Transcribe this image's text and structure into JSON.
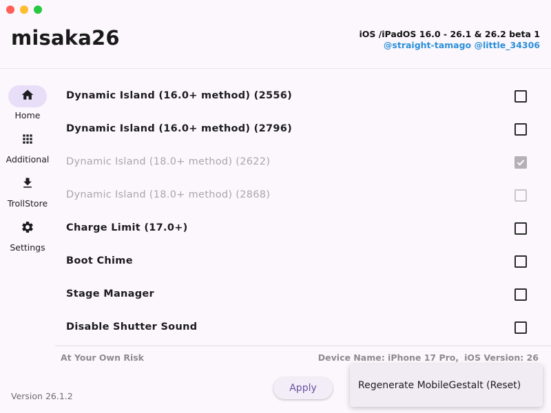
{
  "window": {
    "controls": [
      "close",
      "minimize",
      "maximize"
    ]
  },
  "header": {
    "app_title": "misaka26",
    "os_range": "iOS /iPadOS 16.0 - 26.1 & 26.2 beta 1",
    "credits": "@straight-tamago @little_34306"
  },
  "sidebar": {
    "items": [
      {
        "label": "Home",
        "icon": "home-icon",
        "selected": true
      },
      {
        "label": "Additional",
        "icon": "grid-icon",
        "selected": false
      },
      {
        "label": "TrollStore",
        "icon": "download-icon",
        "selected": false
      },
      {
        "label": "Settings",
        "icon": "gear-icon",
        "selected": false
      }
    ]
  },
  "tweaks": [
    {
      "label": "Dynamic Island (16.0+ method) (2556)",
      "checked": false,
      "enabled": true
    },
    {
      "label": "Dynamic Island (16.0+ method) (2796)",
      "checked": false,
      "enabled": true
    },
    {
      "label": "Dynamic Island (18.0+ method) (2622)",
      "checked": true,
      "enabled": false
    },
    {
      "label": "Dynamic Island (18.0+ method) (2868)",
      "checked": false,
      "enabled": false
    },
    {
      "label": "Charge Limit (17.0+)",
      "checked": false,
      "enabled": true
    },
    {
      "label": "Boot Chime",
      "checked": false,
      "enabled": true
    },
    {
      "label": "Stage Manager",
      "checked": false,
      "enabled": true
    },
    {
      "label": "Disable Shutter Sound",
      "checked": false,
      "enabled": true
    }
  ],
  "footer": {
    "risk_text": "At Your Own Risk",
    "device_name": "Device Name: iPhone 17 Pro,",
    "ios_version": "iOS Version: 26",
    "version": "Version 26.1.2",
    "apply_label": "Apply"
  },
  "menu": {
    "items": [
      "Regenerate MobileGestalt (Reset)"
    ]
  },
  "colors": {
    "accent": "#6750a4",
    "credits": "#2b8fd8",
    "nav_selected": "#e8def8",
    "background": "#fbf7fc"
  }
}
